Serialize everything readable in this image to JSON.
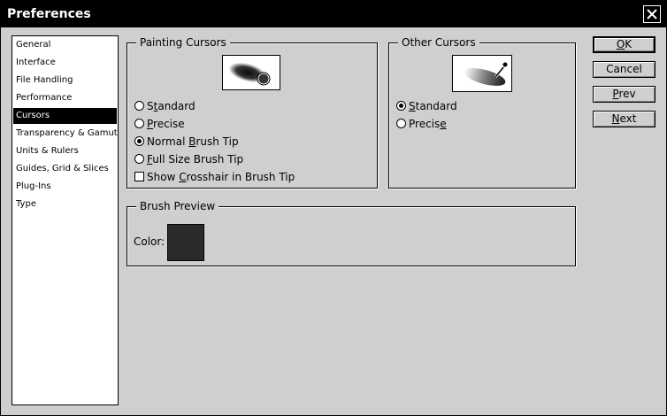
{
  "window": {
    "title": "Preferences"
  },
  "categories": [
    {
      "label": "General"
    },
    {
      "label": "Interface"
    },
    {
      "label": "File Handling"
    },
    {
      "label": "Performance"
    },
    {
      "label": "Cursors",
      "selected": true
    },
    {
      "label": "Transparency & Gamut"
    },
    {
      "label": "Units & Rulers"
    },
    {
      "label": "Guides, Grid & Slices"
    },
    {
      "label": "Plug-Ins"
    },
    {
      "label": "Type"
    }
  ],
  "painting_cursors": {
    "legend": "Painting Cursors",
    "standard": {
      "pre": "S",
      "u": "t",
      "post": "andard"
    },
    "precise": {
      "pre": "",
      "u": "P",
      "post": "recise"
    },
    "normal": {
      "pre": "Normal ",
      "u": "B",
      "post": "rush Tip"
    },
    "full": {
      "pre": "",
      "u": "F",
      "post": "ull Size Brush Tip"
    },
    "crosshair": {
      "pre": "Show ",
      "u": "C",
      "post": "rosshair in Brush Tip"
    },
    "selected": "normal"
  },
  "other_cursors": {
    "legend": "Other Cursors",
    "standard": {
      "pre": "",
      "u": "S",
      "post": "tandard"
    },
    "precise": {
      "pre": "Precis",
      "u": "e",
      "post": ""
    },
    "selected": "standard"
  },
  "brush_preview": {
    "legend": "Brush Preview",
    "color_label": "Color:",
    "color": "#2a2a2a"
  },
  "buttons": {
    "ok": {
      "pre": "",
      "u": "O",
      "post": "K"
    },
    "cancel": {
      "pre": "Cancel",
      "u": "",
      "post": ""
    },
    "prev": {
      "pre": "",
      "u": "P",
      "post": "rev"
    },
    "next": {
      "pre": "",
      "u": "N",
      "post": "ext"
    }
  }
}
